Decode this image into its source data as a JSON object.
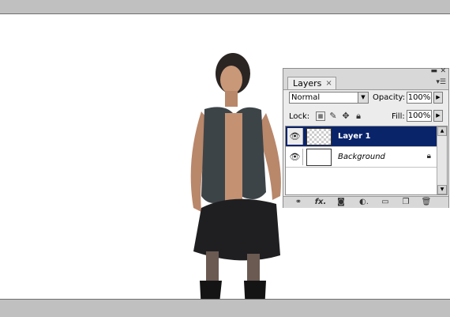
{
  "panel": {
    "tab_label": "Layers",
    "tab_close": "×",
    "blend_mode": "Normal",
    "opacity_label": "Opacity:",
    "opacity_value": "100%",
    "lock_label": "Lock:",
    "fill_label": "Fill:",
    "fill_value": "100%",
    "layers": [
      {
        "name": "Layer 1",
        "selected": true
      },
      {
        "name": "Background",
        "selected": false,
        "locked": true
      }
    ],
    "bottom_icons": [
      "link-icon",
      "fx-icon",
      "mask-icon",
      "adjustment-icon",
      "folder-icon",
      "new-layer-icon",
      "trash-icon"
    ]
  },
  "colors": {
    "selection": "#0a246a",
    "chrome": "#c0c0c0",
    "panel_bg": "#ececec"
  }
}
